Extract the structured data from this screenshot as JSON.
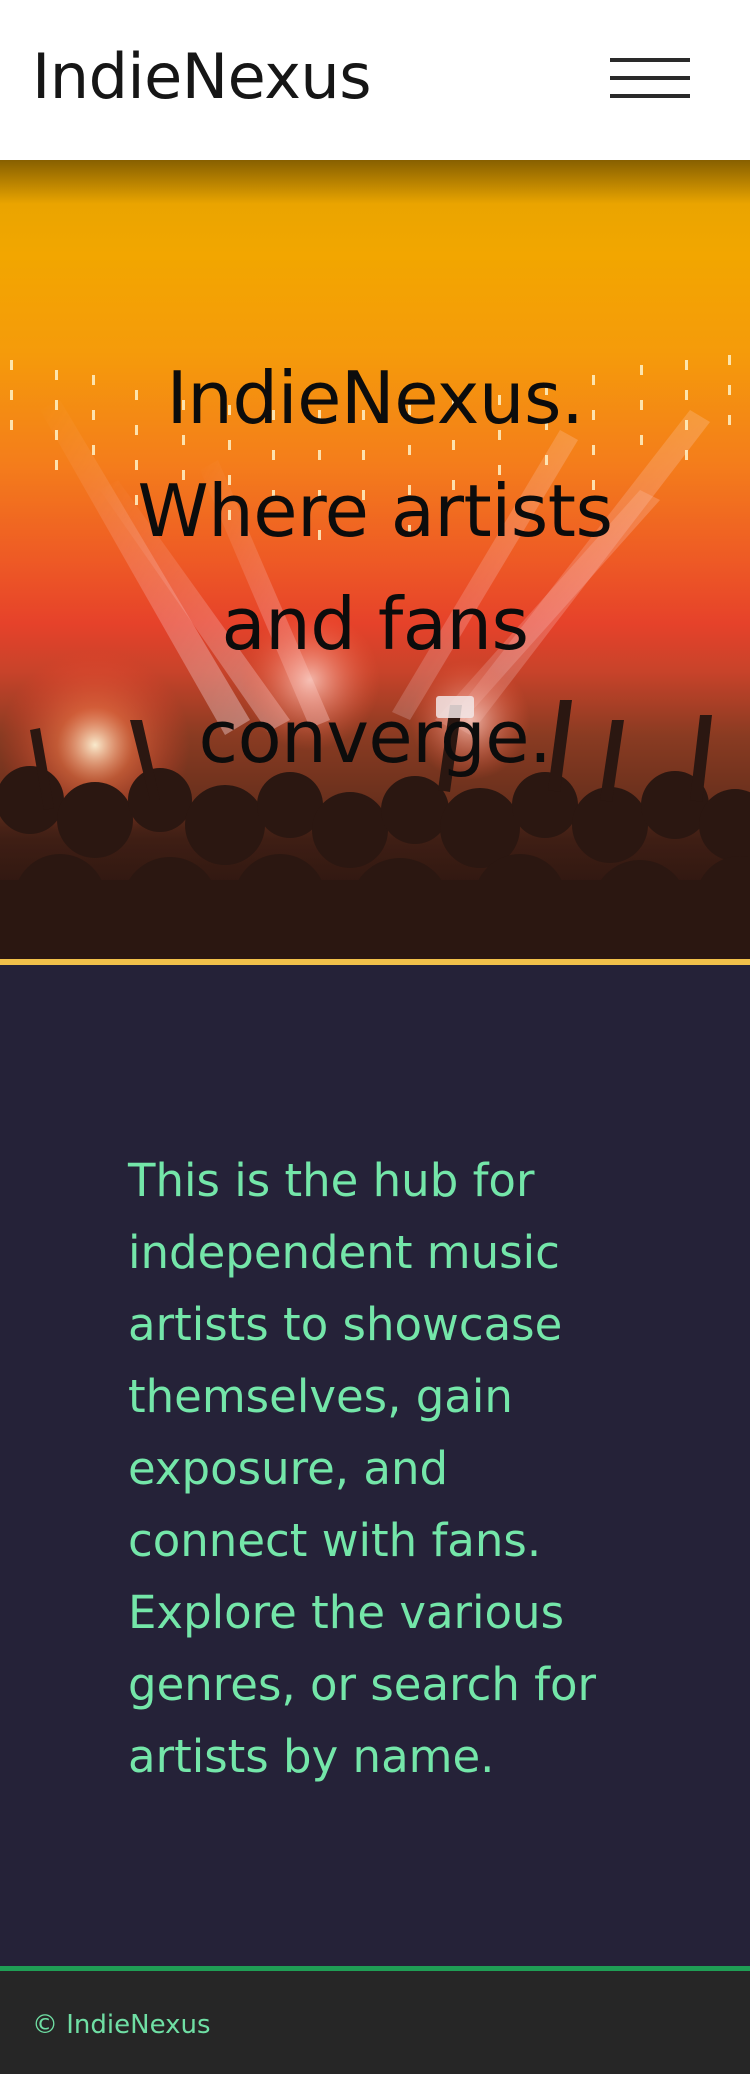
{
  "header": {
    "brand": "IndieNexus",
    "menu_icon": "hamburger-menu-icon"
  },
  "hero": {
    "title_lines": [
      "IndieNexus.",
      "Where artists",
      "and fans",
      "converge."
    ],
    "image": "concert-crowd-stage-lights"
  },
  "intro": {
    "text": "This is the hub for independent music artists to showcase themselves, gain exposure, and connect with fans. Explore the various genres, or search for artists by name."
  },
  "footer": {
    "copyright": "© IndieNexus"
  },
  "colors": {
    "header_bg": "#ffffff",
    "intro_bg": "#252238",
    "intro_text": "#74e6a9",
    "hero_rule": "#f1c04a",
    "footer_rule": "#1f9e55",
    "footer_bg": "#262626"
  }
}
